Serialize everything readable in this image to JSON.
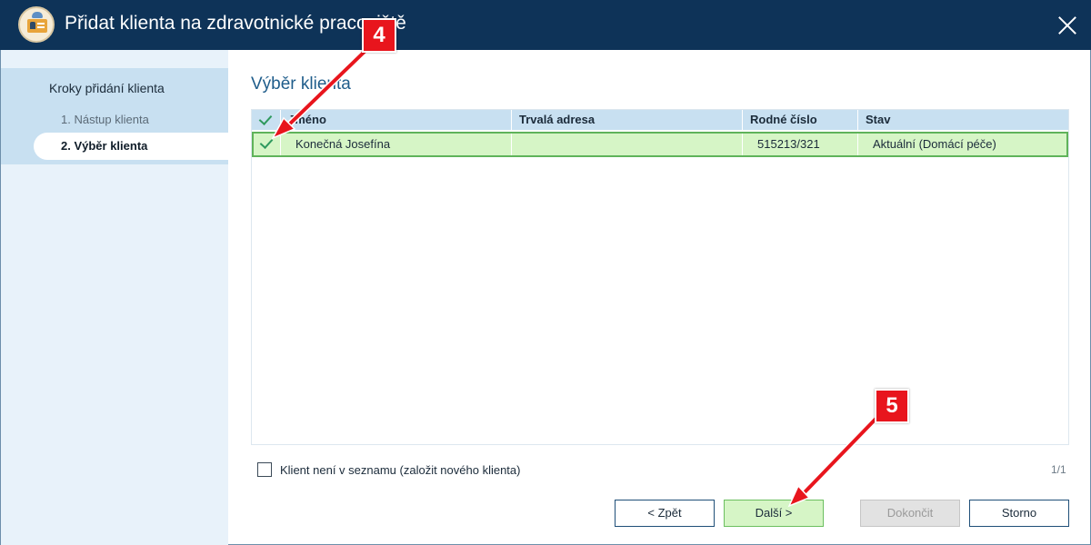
{
  "window": {
    "title": "Přidat klienta na zdravotnické pracoviště",
    "colors": {
      "titlebar": "#0e3358",
      "accent": "#1f5d8b",
      "selected_row": "#d6f5c6",
      "callout": "#e8151d"
    }
  },
  "sidebar": {
    "title": "Kroky přidání klienta",
    "steps": [
      {
        "label": "1. Nástup klienta",
        "active": false
      },
      {
        "label": "2. Výběr klienta",
        "active": true
      }
    ]
  },
  "main": {
    "section_title": "Výběr klienta",
    "table": {
      "columns": [
        "",
        "Jméno",
        "Trvalá adresa",
        "Rodné číslo",
        "Stav"
      ],
      "rows": [
        {
          "checked": true,
          "name": "Konečná Josefína",
          "address": "",
          "birth_number": "515213/321",
          "status": "Aktuální (Domácí péče)"
        }
      ]
    },
    "checkbox": {
      "label": "Klient není v seznamu (založit nového klienta)",
      "checked": false
    },
    "pager": "1/1",
    "buttons": {
      "back": "< Zpět",
      "next": "Další >",
      "finish": "Dokončit",
      "cancel": "Storno"
    }
  },
  "callouts": [
    "4",
    "5"
  ],
  "icons": [
    "client-card-icon",
    "close-icon",
    "check-icon"
  ]
}
